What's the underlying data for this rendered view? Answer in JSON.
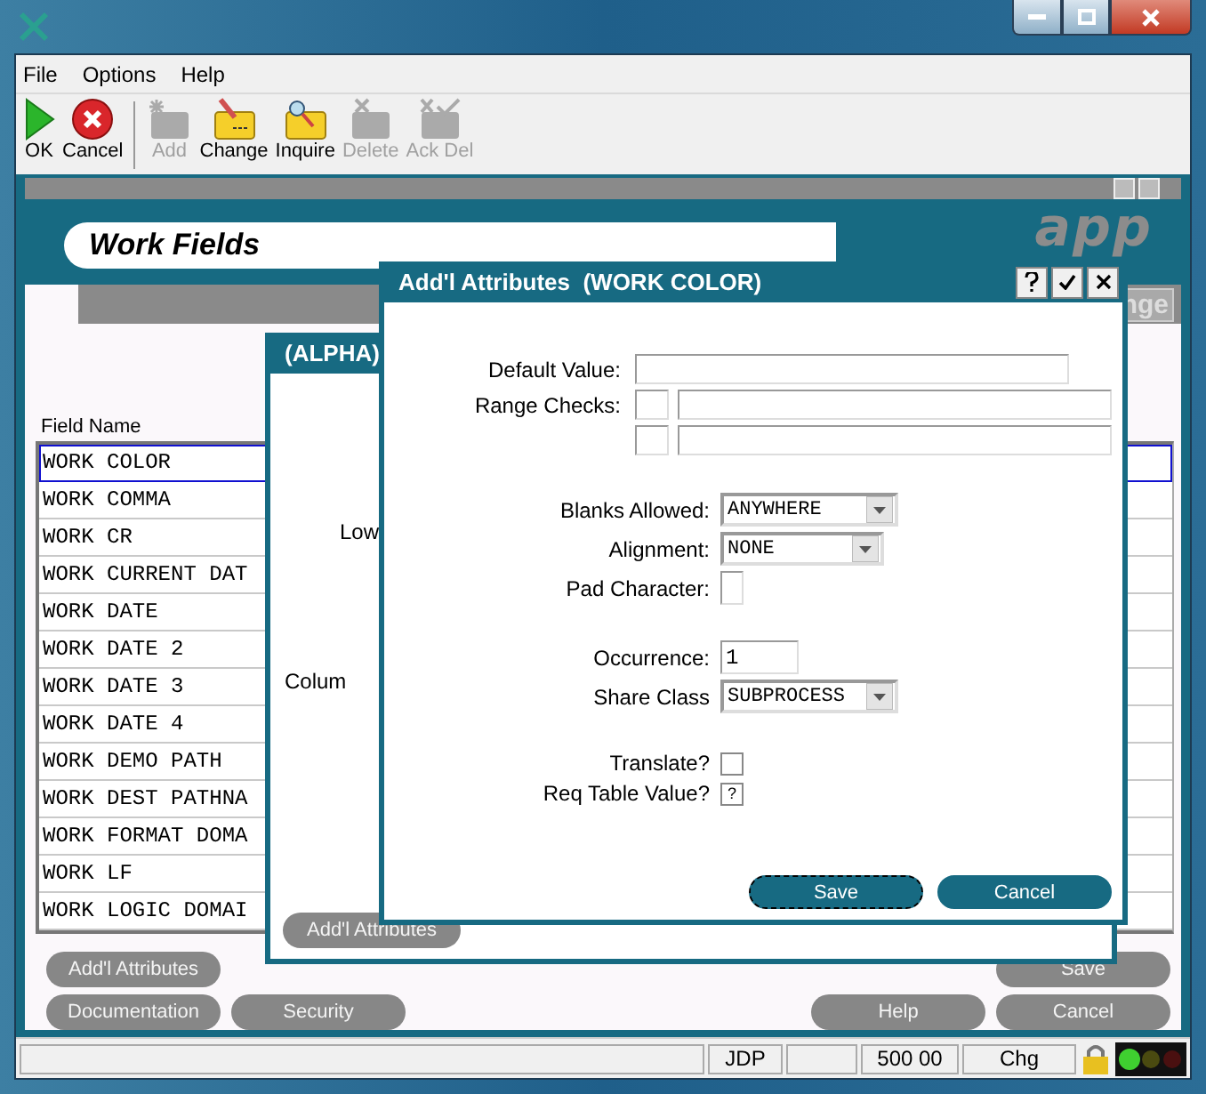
{
  "menu": [
    "File",
    "Options",
    "Help"
  ],
  "toolbar": [
    {
      "label": "OK",
      "kind": "ok",
      "disabled": false
    },
    {
      "label": "Cancel",
      "kind": "cancel",
      "disabled": false
    },
    {
      "label": "Add",
      "kind": "add",
      "disabled": true
    },
    {
      "label": "Change",
      "kind": "change",
      "disabled": false
    },
    {
      "label": "Inquire",
      "kind": "inquire",
      "disabled": false
    },
    {
      "label": "Delete",
      "kind": "delete",
      "disabled": true
    },
    {
      "label": "Ack Del",
      "kind": "ackdel",
      "disabled": true
    }
  ],
  "panel": {
    "title": "Work Fields",
    "logo": "app",
    "header_button": "nge"
  },
  "list": {
    "column": "Field Name",
    "rows": [
      {
        "name": "WORK COLOR",
        "selected": true
      },
      {
        "name": "WORK COMMA",
        "selected": false
      },
      {
        "name": "WORK CR",
        "selected": false
      },
      {
        "name": "WORK CURRENT DAT",
        "selected": false
      },
      {
        "name": "WORK DATE",
        "selected": false
      },
      {
        "name": "WORK DATE 2",
        "selected": false
      },
      {
        "name": "WORK DATE 3",
        "selected": false
      },
      {
        "name": "WORK DATE 4",
        "selected": false
      },
      {
        "name": "WORK DEMO PATH",
        "selected": false
      },
      {
        "name": "WORK DEST PATHNA",
        "selected": false
      },
      {
        "name": "WORK FORMAT DOMA",
        "selected": false
      },
      {
        "name": "WORK LF",
        "selected": false
      },
      {
        "name": "WORK LOGIC DOMAI",
        "selected": false
      }
    ]
  },
  "back_dialog": {
    "title": "(ALPHA)",
    "labels": [
      "Low",
      "Colum"
    ],
    "button": "Add'l Attributes"
  },
  "dialog": {
    "title": "Add'l Attributes  (WORK COLOR)",
    "groups": [
      [
        {
          "label": "Default Value:",
          "kind": "text"
        },
        {
          "label": "Range Checks:",
          "kind": "range"
        },
        {
          "kind": "range"
        }
      ],
      [
        {
          "label": "Blanks Allowed:",
          "kind": "select",
          "value": "ANYWHERE"
        },
        {
          "label": "Alignment:",
          "kind": "select",
          "value": "NONE"
        },
        {
          "label": "Pad Character:",
          "kind": "char"
        }
      ],
      [
        {
          "label": "Occurrence:",
          "kind": "short",
          "value": "1"
        },
        {
          "label": "Share Class",
          "kind": "select",
          "value": "SUBPROCESS"
        }
      ],
      [
        {
          "label": "Translate?",
          "kind": "check",
          "checked": false
        },
        {
          "label": "Req Table Value?",
          "kind": "flag",
          "value": "?"
        }
      ]
    ],
    "buttons": [
      {
        "label": "Save",
        "focused": true
      },
      {
        "label": "Cancel",
        "focused": false
      }
    ]
  },
  "buttons": {
    "left_top": [
      "Add'l Attributes"
    ],
    "left_bottom": [
      "Documentation",
      "Security"
    ],
    "right_top": [
      "Save"
    ],
    "right_bottom": [
      "Help",
      "Cancel"
    ]
  },
  "status_bar": {
    "user": "JDP",
    "amount": "500 00",
    "mode": "Chg"
  }
}
